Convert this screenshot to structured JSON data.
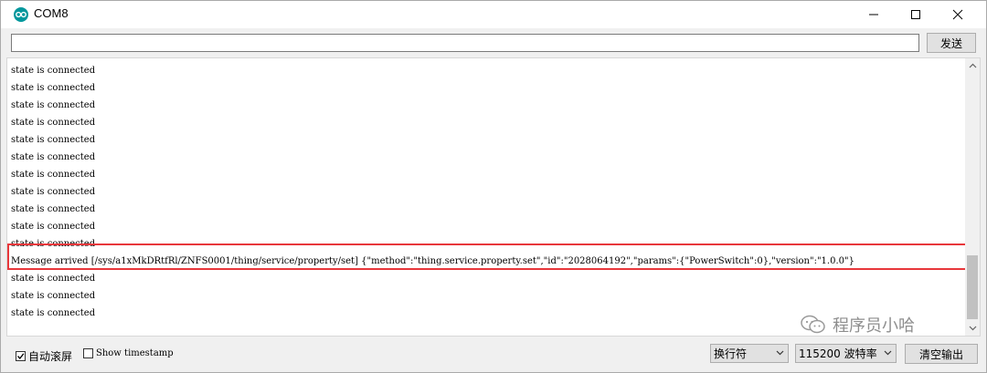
{
  "window": {
    "title": "COM8"
  },
  "send": {
    "input_value": "",
    "button_label": "发送"
  },
  "output": {
    "lines": [
      "state is connected",
      "state is connected",
      "state is connected",
      "state is connected",
      "state is connected",
      "state is connected",
      "state is connected",
      "state is connected",
      "state is connected",
      "state is connected",
      "state is connected",
      "Message arrived [/sys/a1xMkDRtfRl/ZNFS0001/thing/service/property/set] {\"method\":\"thing.service.property.set\",\"id\":\"2028064192\",\"params\":{\"PowerSwitch\":0},\"version\":\"1.0.0\"}",
      "state is connected",
      "state is connected",
      "state is connected"
    ]
  },
  "watermark": {
    "text": "程序员小哈"
  },
  "bottom": {
    "autoscroll_label": "自动滚屏",
    "autoscroll_checked": true,
    "timestamp_label": "Show timestamp",
    "timestamp_checked": false,
    "line_ending_value": "换行符",
    "baud_value": "115200 波特率",
    "clear_label": "清空输出"
  },
  "colors": {
    "highlight": "#e8373b",
    "brand": "#00979c"
  }
}
